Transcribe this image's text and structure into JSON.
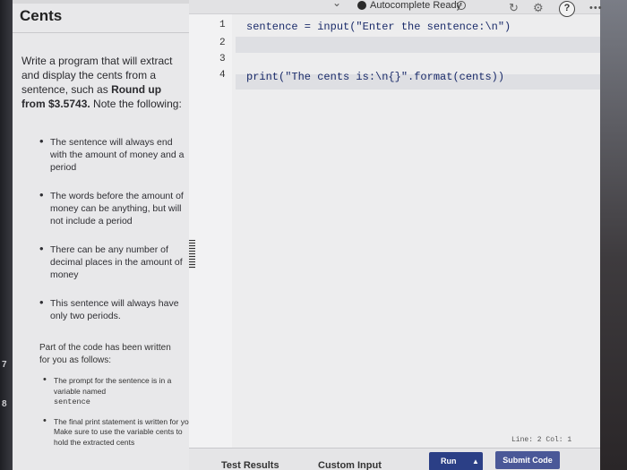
{
  "panel": {
    "title": "Cents",
    "intro_pre": "Write a program that will extract and display the cents from a sentence, such as ",
    "intro_bold": "Round up from $3.5743.",
    "intro_post": " Note the following:",
    "bullets": [
      "The sentence will always end with the amount of money and a period",
      "The words before the amount of money can be anything, but will not include a period",
      "There can be any number of decimal places in the amount of money",
      "This sentence will always have only two periods."
    ],
    "part_heading": "Part of the code has been written for you as follows:",
    "bullets2": [
      {
        "pre": "The prompt for the sentence is in a variable named ",
        "code": "sentence",
        "post": ""
      },
      {
        "pre": "The final print statement is written for you. Make sure to use the variable ",
        "code": "cents",
        "post": " to hold the extracted cents"
      }
    ]
  },
  "editor": {
    "status_text": "Autocomplete Ready",
    "line_numbers": [
      "1",
      "2",
      "3",
      "4"
    ],
    "code_lines": [
      "sentence = input(\"Enter the sentence:\\n\")",
      "",
      "",
      "print(\"The cents is:\\n{}\".format(cents))"
    ],
    "cursor_position": "Line: 2 Col: 1"
  },
  "bottom": {
    "test_results_label": "Test Results",
    "custom_input_label": "Custom Input",
    "run_label": "Run",
    "submit_label": "Submit Code"
  },
  "edge_marks": [
    "7",
    "8"
  ],
  "colors": {
    "submit": "#4a5898",
    "run": "#2b3f86",
    "code_text": "#1a2b6a"
  }
}
